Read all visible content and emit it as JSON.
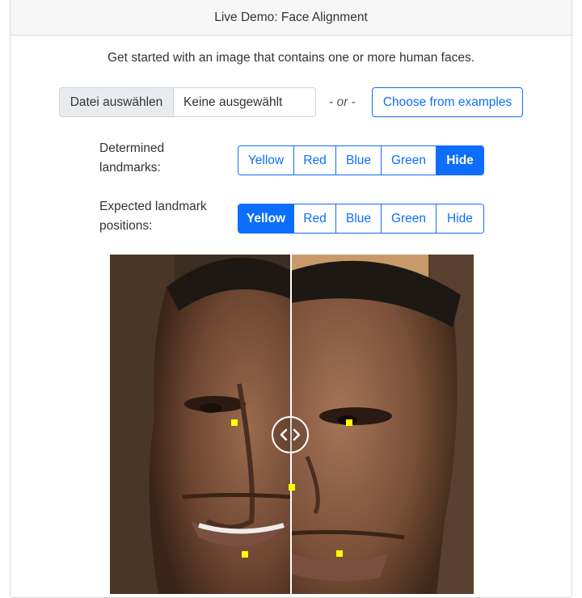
{
  "header": {
    "title": "Live Demo: Face Alignment"
  },
  "intro": {
    "text": "Get started with an image that contains one or more human faces."
  },
  "file_input": {
    "button_label": "Datei auswählen",
    "value": "Keine ausgewählt"
  },
  "or_text": "- or -",
  "examples_button": {
    "label": "Choose from examples"
  },
  "determined_landmarks": {
    "label": "Determined landmarks:",
    "options": [
      "Yellow",
      "Red",
      "Blue",
      "Green",
      "Hide"
    ],
    "selected": "Hide"
  },
  "expected_landmarks": {
    "label": "Expected landmark positions:",
    "options": [
      "Yellow",
      "Red",
      "Blue",
      "Green",
      "Hide"
    ],
    "selected": "Yellow"
  },
  "colors": {
    "primary": "#0d6efd",
    "landmark": "#ffff00",
    "header_bg": "#f7f7f7",
    "file_btn_bg": "#e9ecef"
  },
  "comparison": {
    "left_image": "face-photo-aligned",
    "right_image": "face-photo-original",
    "handle_icon": "chevron-left-right-icon"
  }
}
